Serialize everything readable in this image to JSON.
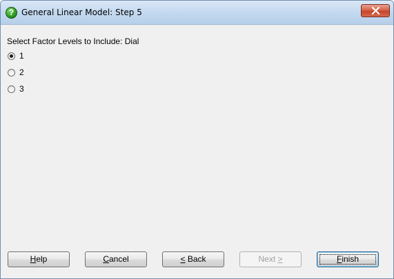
{
  "window": {
    "title": "General Linear Model: Step 5",
    "app_icon": "help-question-icon",
    "app_icon_glyph": "?",
    "close_icon": "close-icon"
  },
  "prompt": "Select Factor Levels to Include: Dial",
  "options": [
    {
      "label": "1",
      "selected": true
    },
    {
      "label": "2",
      "selected": false
    },
    {
      "label": "3",
      "selected": false
    }
  ],
  "buttons": {
    "help": {
      "pre": "",
      "mnemonic": "H",
      "post": "elp",
      "enabled": true
    },
    "cancel": {
      "pre": "",
      "mnemonic": "C",
      "post": "ancel",
      "enabled": true
    },
    "back": {
      "pre": "",
      "mnemonic": "<",
      "post": " Back",
      "enabled": true
    },
    "next": {
      "pre": "Next ",
      "mnemonic": ">",
      "post": "",
      "enabled": false
    },
    "finish": {
      "pre": "",
      "mnemonic": "F",
      "post": "inish",
      "enabled": true
    }
  },
  "colors": {
    "title_gradient_top": "#dbe8f6",
    "close_button": "#c7432a",
    "dialog_bg": "#f0f0f0",
    "disabled_text": "#a0a0a0"
  }
}
